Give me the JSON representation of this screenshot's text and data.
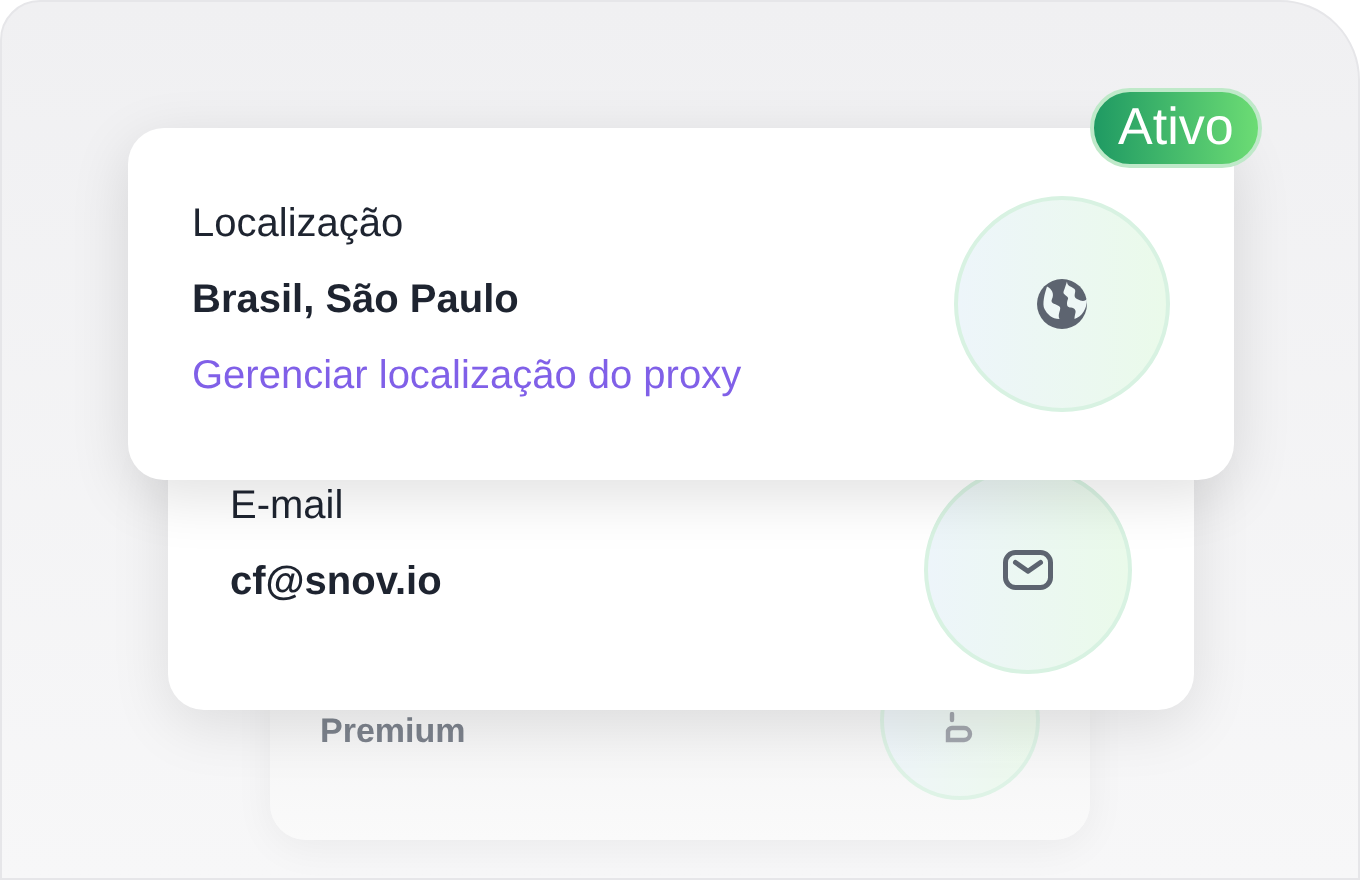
{
  "cards": [
    {
      "kind": "location",
      "label": "Localização",
      "value": "Brasil, São Paulo",
      "link": "Gerenciar localização do proxy",
      "badge": "Ativo"
    },
    {
      "kind": "email",
      "label": "E-mail",
      "value": "cf@snov.io"
    },
    {
      "kind": "plan",
      "label": "Premium"
    }
  ]
}
